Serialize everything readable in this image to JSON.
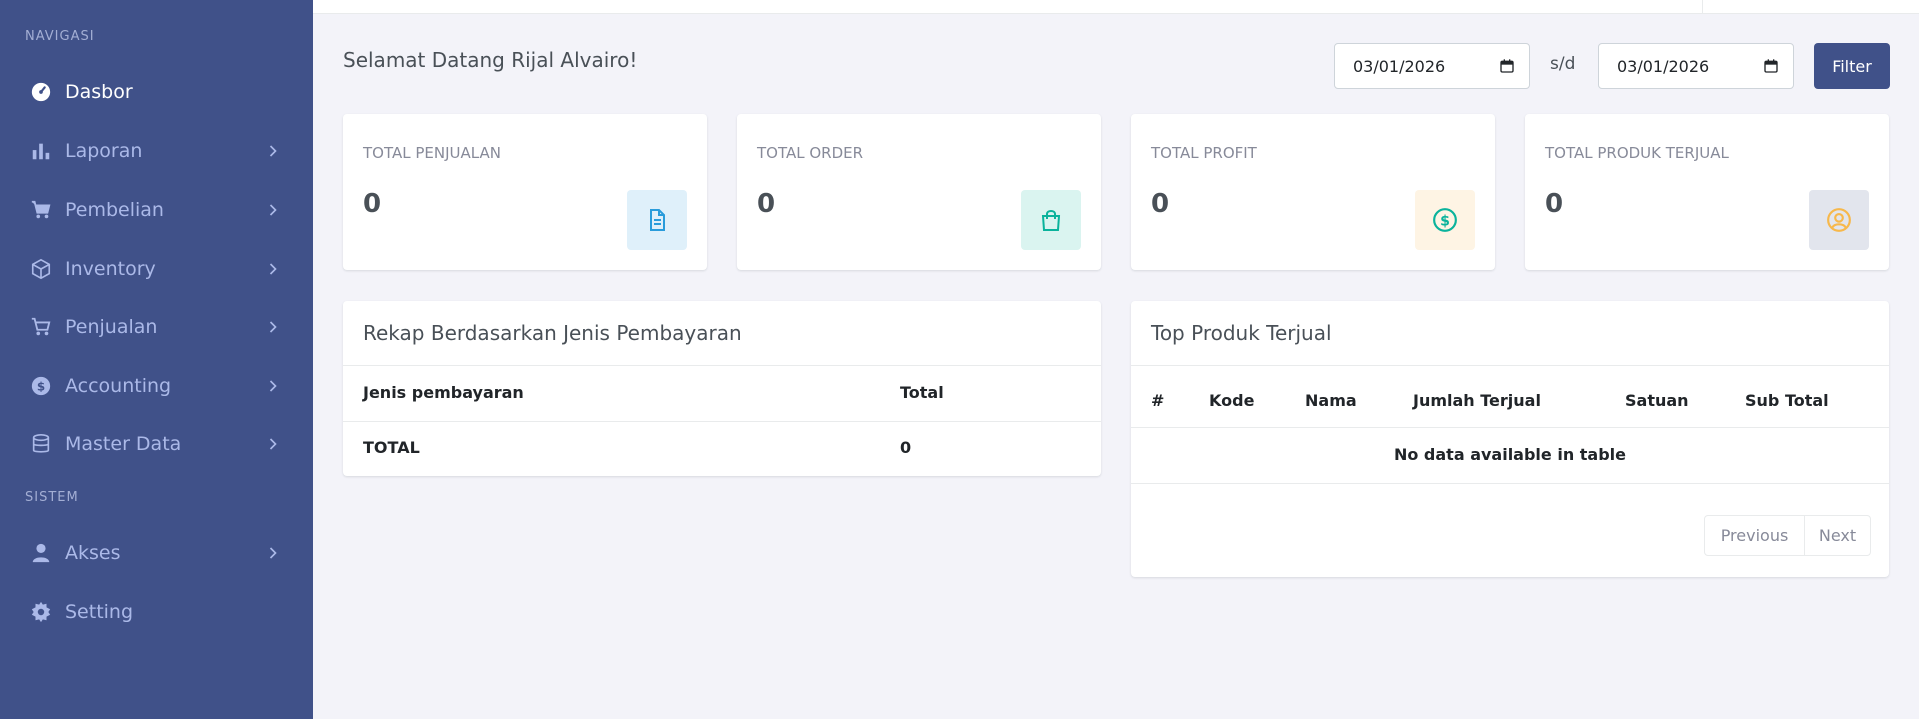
{
  "sidebar": {
    "section_nav": "NAVIGASI",
    "section_system": "SISTEM",
    "items": [
      {
        "label": "Dasbor",
        "icon": "dashboard-icon"
      },
      {
        "label": "Laporan",
        "icon": "bar-chart-icon"
      },
      {
        "label": "Pembelian",
        "icon": "cart-icon"
      },
      {
        "label": "Inventory",
        "icon": "box-icon"
      },
      {
        "label": "Penjualan",
        "icon": "shopping-cart-icon"
      },
      {
        "label": "Accounting",
        "icon": "dollar-circle-icon"
      },
      {
        "label": "Master Data",
        "icon": "database-icon"
      },
      {
        "label": "Akses",
        "icon": "user-icon"
      },
      {
        "label": "Setting",
        "icon": "gear-icon"
      }
    ]
  },
  "header": {
    "welcome": "Selamat Datang Rijal Alvairo!",
    "date_from": "03/01/2026",
    "separator": "s/d",
    "date_to": "03/01/2026",
    "filter_label": "Filter"
  },
  "stats": [
    {
      "label": "TOTAL PENJUALAN",
      "value": "0",
      "icon": "document-icon",
      "bg": "#dff0fa",
      "color": "#299cdb"
    },
    {
      "label": "TOTAL ORDER",
      "value": "0",
      "icon": "shopping-bag-icon",
      "bg": "#daf4f0",
      "color": "#0ab39c"
    },
    {
      "label": "TOTAL PROFIT",
      "value": "0",
      "icon": "dollar-circle-icon",
      "bg": "#fef4e4",
      "color": "#0ab39c"
    },
    {
      "label": "TOTAL PRODUK TERJUAL",
      "value": "0",
      "icon": "user-circle-icon",
      "bg": "#e2e5ed",
      "color": "#f7b84b"
    }
  ],
  "rekap": {
    "title": "Rekap Berdasarkan Jenis Pembayaran",
    "col_jenis": "Jenis pembayaran",
    "col_total": "Total",
    "row_label": "TOTAL",
    "row_value": "0"
  },
  "top_produk": {
    "title": "Top Produk Terjual",
    "columns": [
      "#",
      "Kode",
      "Nama",
      "Jumlah Terjual",
      "Satuan",
      "Sub Total"
    ],
    "empty": "No data available in table",
    "previous": "Previous",
    "next": "Next"
  },
  "colors": {
    "sidebar": "#405189",
    "accent": "#405189"
  }
}
